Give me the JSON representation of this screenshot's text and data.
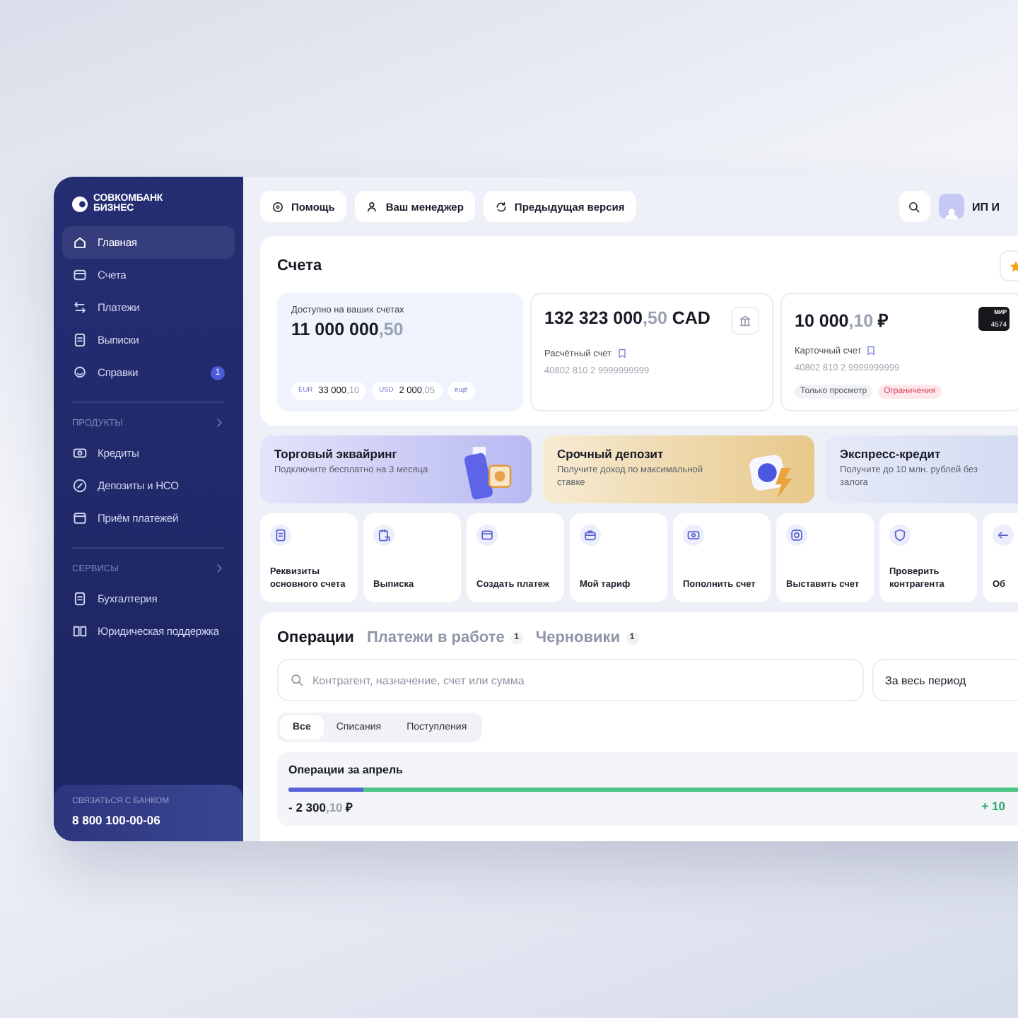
{
  "sidebar": {
    "logo_lines": [
      "СОВКОМБАНК",
      "БИЗНЕС"
    ],
    "items": [
      {
        "label": "Главная",
        "selected": true
      },
      {
        "label": "Счета",
        "selected": false
      },
      {
        "label": "Платежи",
        "selected": false
      },
      {
        "label": "Выписки",
        "selected": false
      },
      {
        "label": "Справки",
        "selected": false,
        "badge": "1"
      }
    ],
    "sections": [
      {
        "title": "ПРОДУКТЫ",
        "items": [
          {
            "label": "Кредиты",
            "selected": false
          },
          {
            "label": "Депозиты и НСО",
            "selected": false
          },
          {
            "label": "Приём платежей",
            "selected": false
          }
        ]
      },
      {
        "title": "СЕРВИСЫ",
        "items": [
          {
            "label": "Бухгалтерия",
            "selected": false
          },
          {
            "label": "Юридическая поддержка",
            "selected": false
          }
        ]
      }
    ],
    "contact": {
      "label": "СВЯЗАТЬСЯ С БАНКОМ",
      "phone": "8 800 100-00-06"
    }
  },
  "topbar": {
    "buttons": [
      {
        "label": "Помощь"
      },
      {
        "label": "Ваш менеджер"
      },
      {
        "label": "Предыдущая версия"
      }
    ],
    "user": "ИП И"
  },
  "accounts": {
    "title": "Счета",
    "summary": {
      "label": "Доступно на ваших счетах",
      "whole": "11 000 000",
      "fraction": ",50",
      "currencies": [
        {
          "code": "EUR",
          "whole": "33 000",
          "fraction": ",10"
        },
        {
          "code": "USD",
          "whole": "2 000",
          "fraction": ",05"
        }
      ],
      "more": "ещё"
    },
    "cards": [
      {
        "kind": "bank",
        "whole": "132 323 000",
        "fraction": ",50",
        "currency": "CAD",
        "name": "Расчётный счет",
        "number": "40802 810 2 9999999999"
      },
      {
        "kind": "card",
        "whole": "10 000",
        "fraction": ",10",
        "currency": "₽",
        "card_brand": "МИР",
        "card_last": "4574",
        "name": "Карточный счет",
        "number": "40802 810 2 9999999999",
        "tags": [
          {
            "label": "Только просмотр",
            "kind": "neutral"
          },
          {
            "label": "Ограничения",
            "kind": "warning"
          }
        ]
      }
    ]
  },
  "promos": [
    {
      "title": "Торговый эквайринг",
      "text": "Подключите бесплатно на 3 месяца"
    },
    {
      "title": "Срочный депозит",
      "text": "Получите доход по максимальной ставке"
    },
    {
      "title": "Экспресс-кредит",
      "text": "Получите до 10 млн. рублей без залога"
    }
  ],
  "quick_actions": [
    {
      "label": "Реквизиты основного счета"
    },
    {
      "label": "Выписка"
    },
    {
      "label": "Создать платеж"
    },
    {
      "label": "Мой тариф"
    },
    {
      "label": "Пополнить счет"
    },
    {
      "label": "Выставить счет"
    },
    {
      "label": "Проверить контрагента"
    },
    {
      "label": "Об"
    }
  ],
  "operations": {
    "tabs": [
      {
        "label": "Операции",
        "selected": true
      },
      {
        "label": "Платежи в работе",
        "badge": "1",
        "selected": false
      },
      {
        "label": "Черновики",
        "badge": "1",
        "selected": false
      }
    ],
    "search": {
      "placeholder": "Контрагент, назначение, счет или сумма"
    },
    "period": "За весь период",
    "filters": [
      {
        "label": "Все",
        "selected": true
      },
      {
        "label": "Списания",
        "selected": false
      },
      {
        "label": "Поступления",
        "selected": false
      }
    ],
    "summary": {
      "title": "Операции за апрель",
      "level": 0.1,
      "outgoing_whole": "- 2 300",
      "outgoing_fraction": ",10",
      "outgoing_currency": "₽",
      "incoming": "+ 10"
    }
  }
}
